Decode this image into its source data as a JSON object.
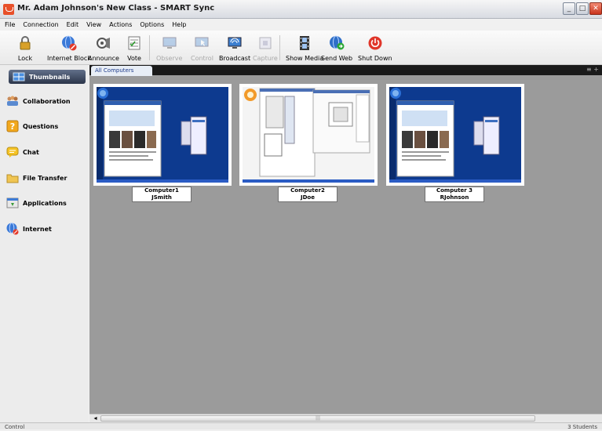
{
  "window": {
    "title": "Mr. Adam Johnson's New Class - SMART Sync"
  },
  "menu": {
    "file": "File",
    "connection": "Connection",
    "edit": "Edit",
    "view": "View",
    "actions": "Actions",
    "options": "Options",
    "help": "Help"
  },
  "toolbar": {
    "lock": "Lock",
    "internet_block": "Internet Block",
    "announce": "Announce",
    "vote": "Vote",
    "observe": "Observe",
    "control": "Control",
    "broadcast": "Broadcast",
    "capture": "Capture",
    "show_media": "Show Media",
    "send_web": "Send Web",
    "shut_down": "Shut Down"
  },
  "sidebar": {
    "thumbnails": "Thumbnails",
    "collaboration": "Collaboration",
    "questions": "Questions",
    "chat": "Chat",
    "file_transfer": "File Transfer",
    "applications": "Applications",
    "internet": "Internet"
  },
  "tabs": {
    "all_computers": "All Computers"
  },
  "computers": [
    {
      "name": "Computer1",
      "user": "JSmith"
    },
    {
      "name": "Computer2",
      "user": "JDoe"
    },
    {
      "name": "Computer 3",
      "user": "RJohnson"
    }
  ],
  "status": {
    "left": "Control",
    "right": "3 Students"
  },
  "colors": {
    "desktop_blue": "#0d3a8f",
    "content_bg": "#9b9b9b",
    "active_sidebar": "#2b354a",
    "shutdown_red": "#e0362a"
  }
}
